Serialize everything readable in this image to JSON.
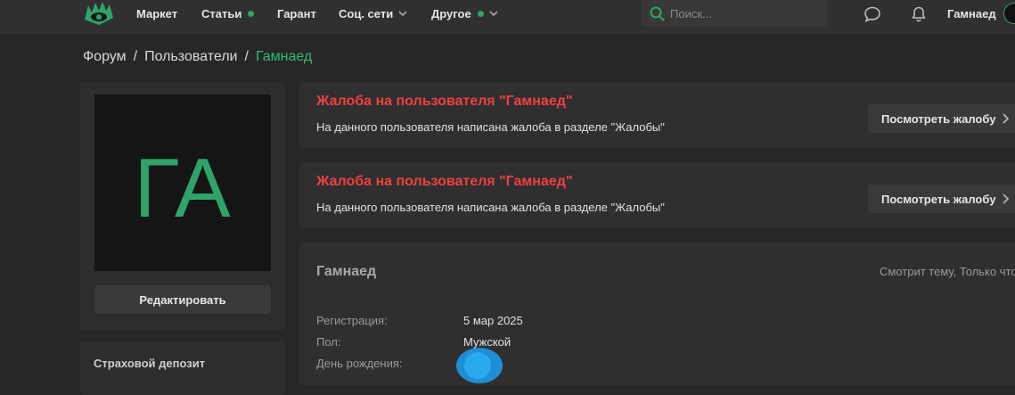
{
  "header": {
    "nav": [
      {
        "label": "Маркет"
      },
      {
        "label": "Статьи"
      },
      {
        "label": "Гарант"
      },
      {
        "label": "Соц. сети"
      },
      {
        "label": "Другое"
      }
    ],
    "search_placeholder": "Поиск...",
    "username": "Гамнаед",
    "accent_color": "#2fa36a"
  },
  "breadcrumb": {
    "items": [
      "Форум",
      "Пользователи"
    ],
    "current": "Гамнаед",
    "separator": "/"
  },
  "sidebar": {
    "avatar_initials": "ГА",
    "edit_label": "Редактировать",
    "deposit_label": "Страховой депозит"
  },
  "alerts": [
    {
      "title": "Жалоба на пользователя \"Гамнаед\"",
      "text": "На данного пользователя написана жалоба в разделе \"Жалобы\"",
      "button": "Посмотреть жалобу"
    },
    {
      "title": "Жалоба на пользователя \"Гамнаед\"",
      "text": "На данного пользователя написана жалоба в разделе \"Жалобы\"",
      "button": "Посмотреть жалобу"
    }
  ],
  "profile": {
    "name": "Гамнаед",
    "status": "Смотрит тему, Только что",
    "fields": [
      {
        "label": "Регистрация:",
        "value": "5 мар 2025"
      },
      {
        "label": "Пол:",
        "value": "Мужской"
      },
      {
        "label": "День рождения:",
        "value": ""
      }
    ]
  }
}
